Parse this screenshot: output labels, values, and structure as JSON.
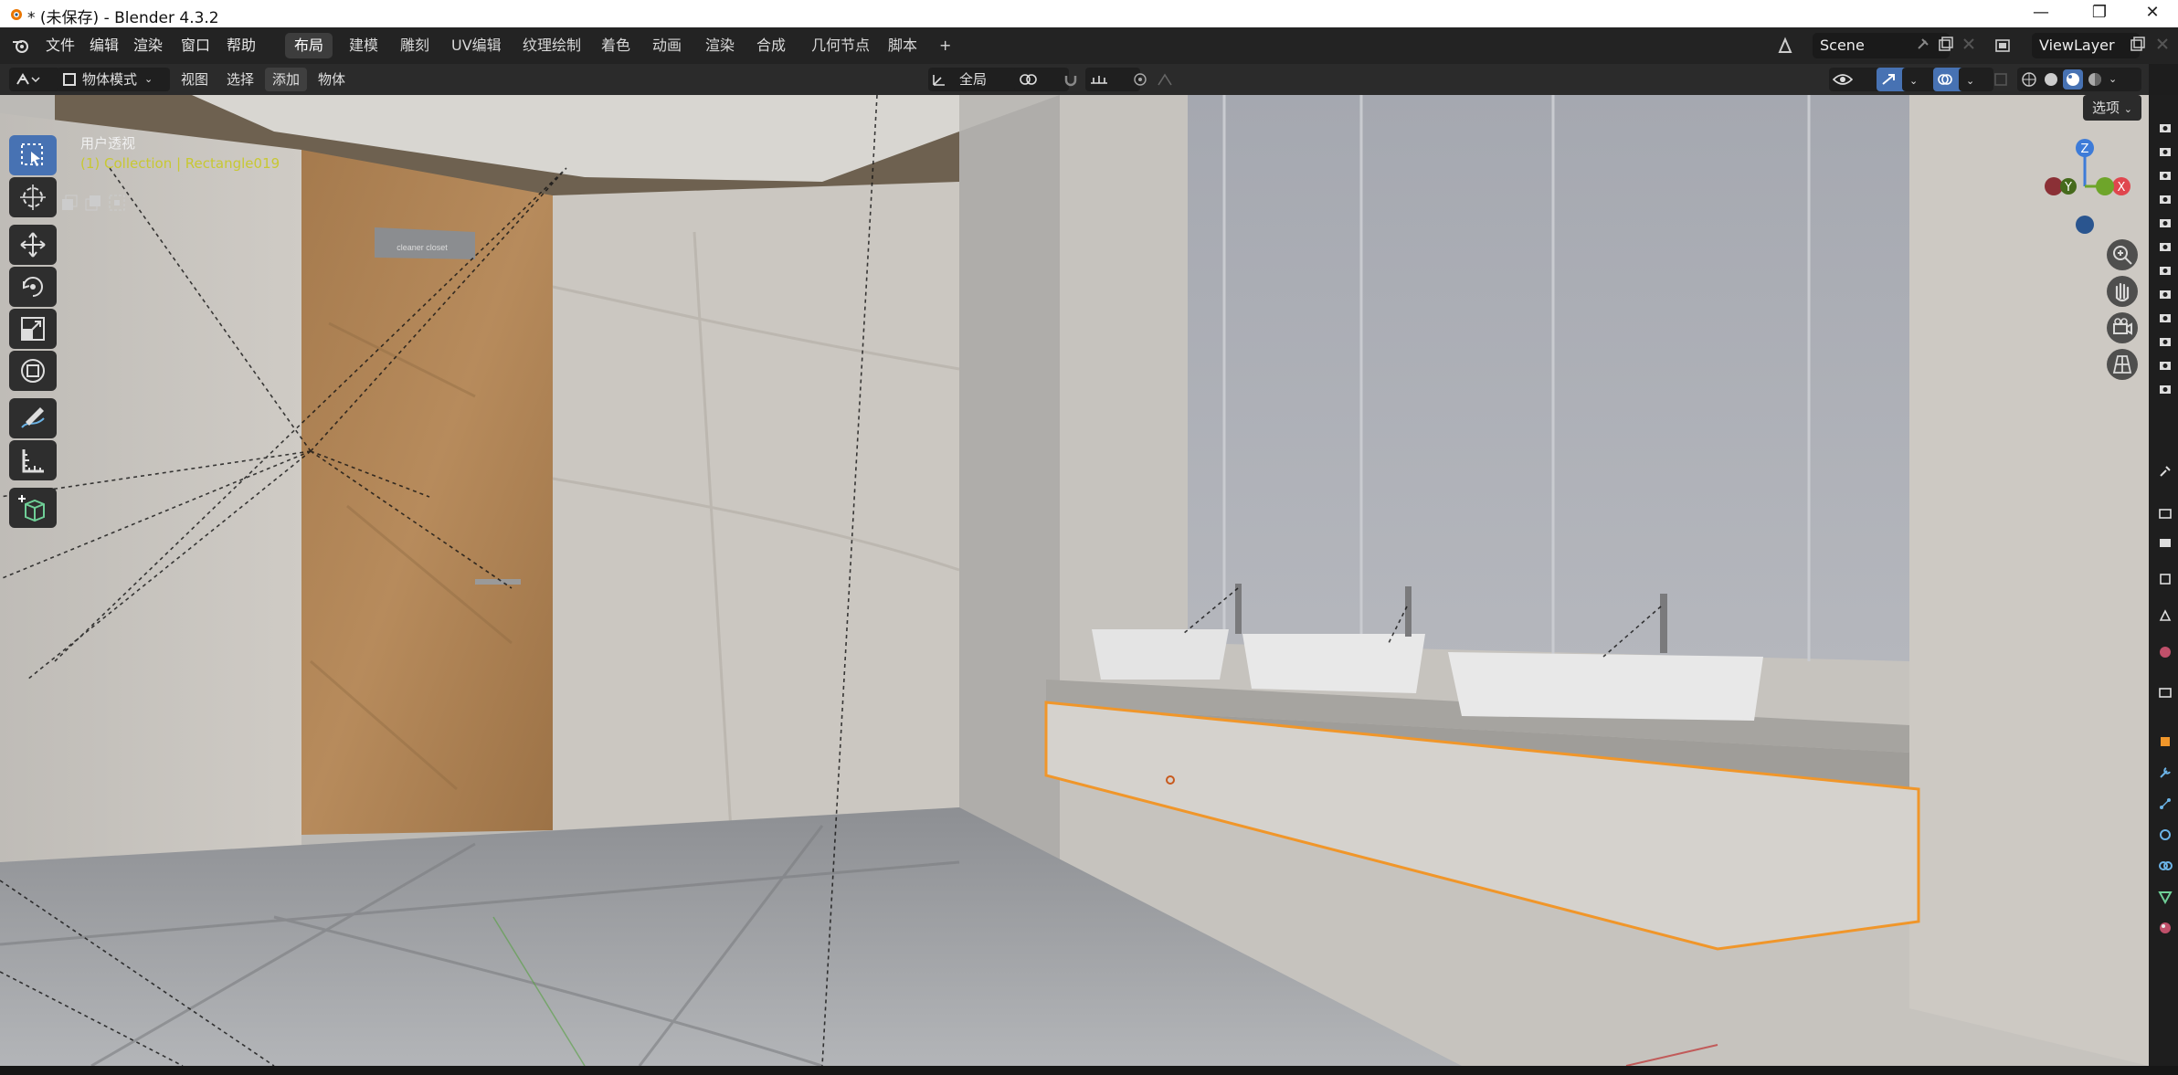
{
  "window": {
    "title": "* (未保存) - Blender 4.3.2",
    "minimize": "—",
    "maximize": "❐",
    "close": "✕"
  },
  "menu": {
    "file": "文件",
    "edit": "编辑",
    "render": "渲染",
    "window": "窗口",
    "help": "帮助"
  },
  "workspaces": [
    "布局",
    "建模",
    "雕刻",
    "UV编辑",
    "纹理绘制",
    "着色",
    "动画",
    "渲染",
    "合成",
    "几何节点",
    "脚本"
  ],
  "workspace_add": "+",
  "scene": {
    "label": "Scene",
    "view_layer": "ViewLayer"
  },
  "header": {
    "mode": "物体模式",
    "view": "视图",
    "select": "选择",
    "add": "添加",
    "object": "物体",
    "transform_orientation": "全局",
    "options": "选项"
  },
  "viewport": {
    "view_name": "用户透视",
    "collection_info": "(1) Collection | Rectangle019",
    "door_sign": "cleaner closet"
  },
  "gizmo": {
    "z": "Z",
    "y": "Y",
    "x": "X"
  },
  "colors": {
    "accent": "#4772b3",
    "selection": "#f0962a",
    "active_text": "#c8c832",
    "gizmo_x": "#e0464e",
    "gizmo_y": "#6ea52a",
    "gizmo_z": "#3d7bd8"
  }
}
